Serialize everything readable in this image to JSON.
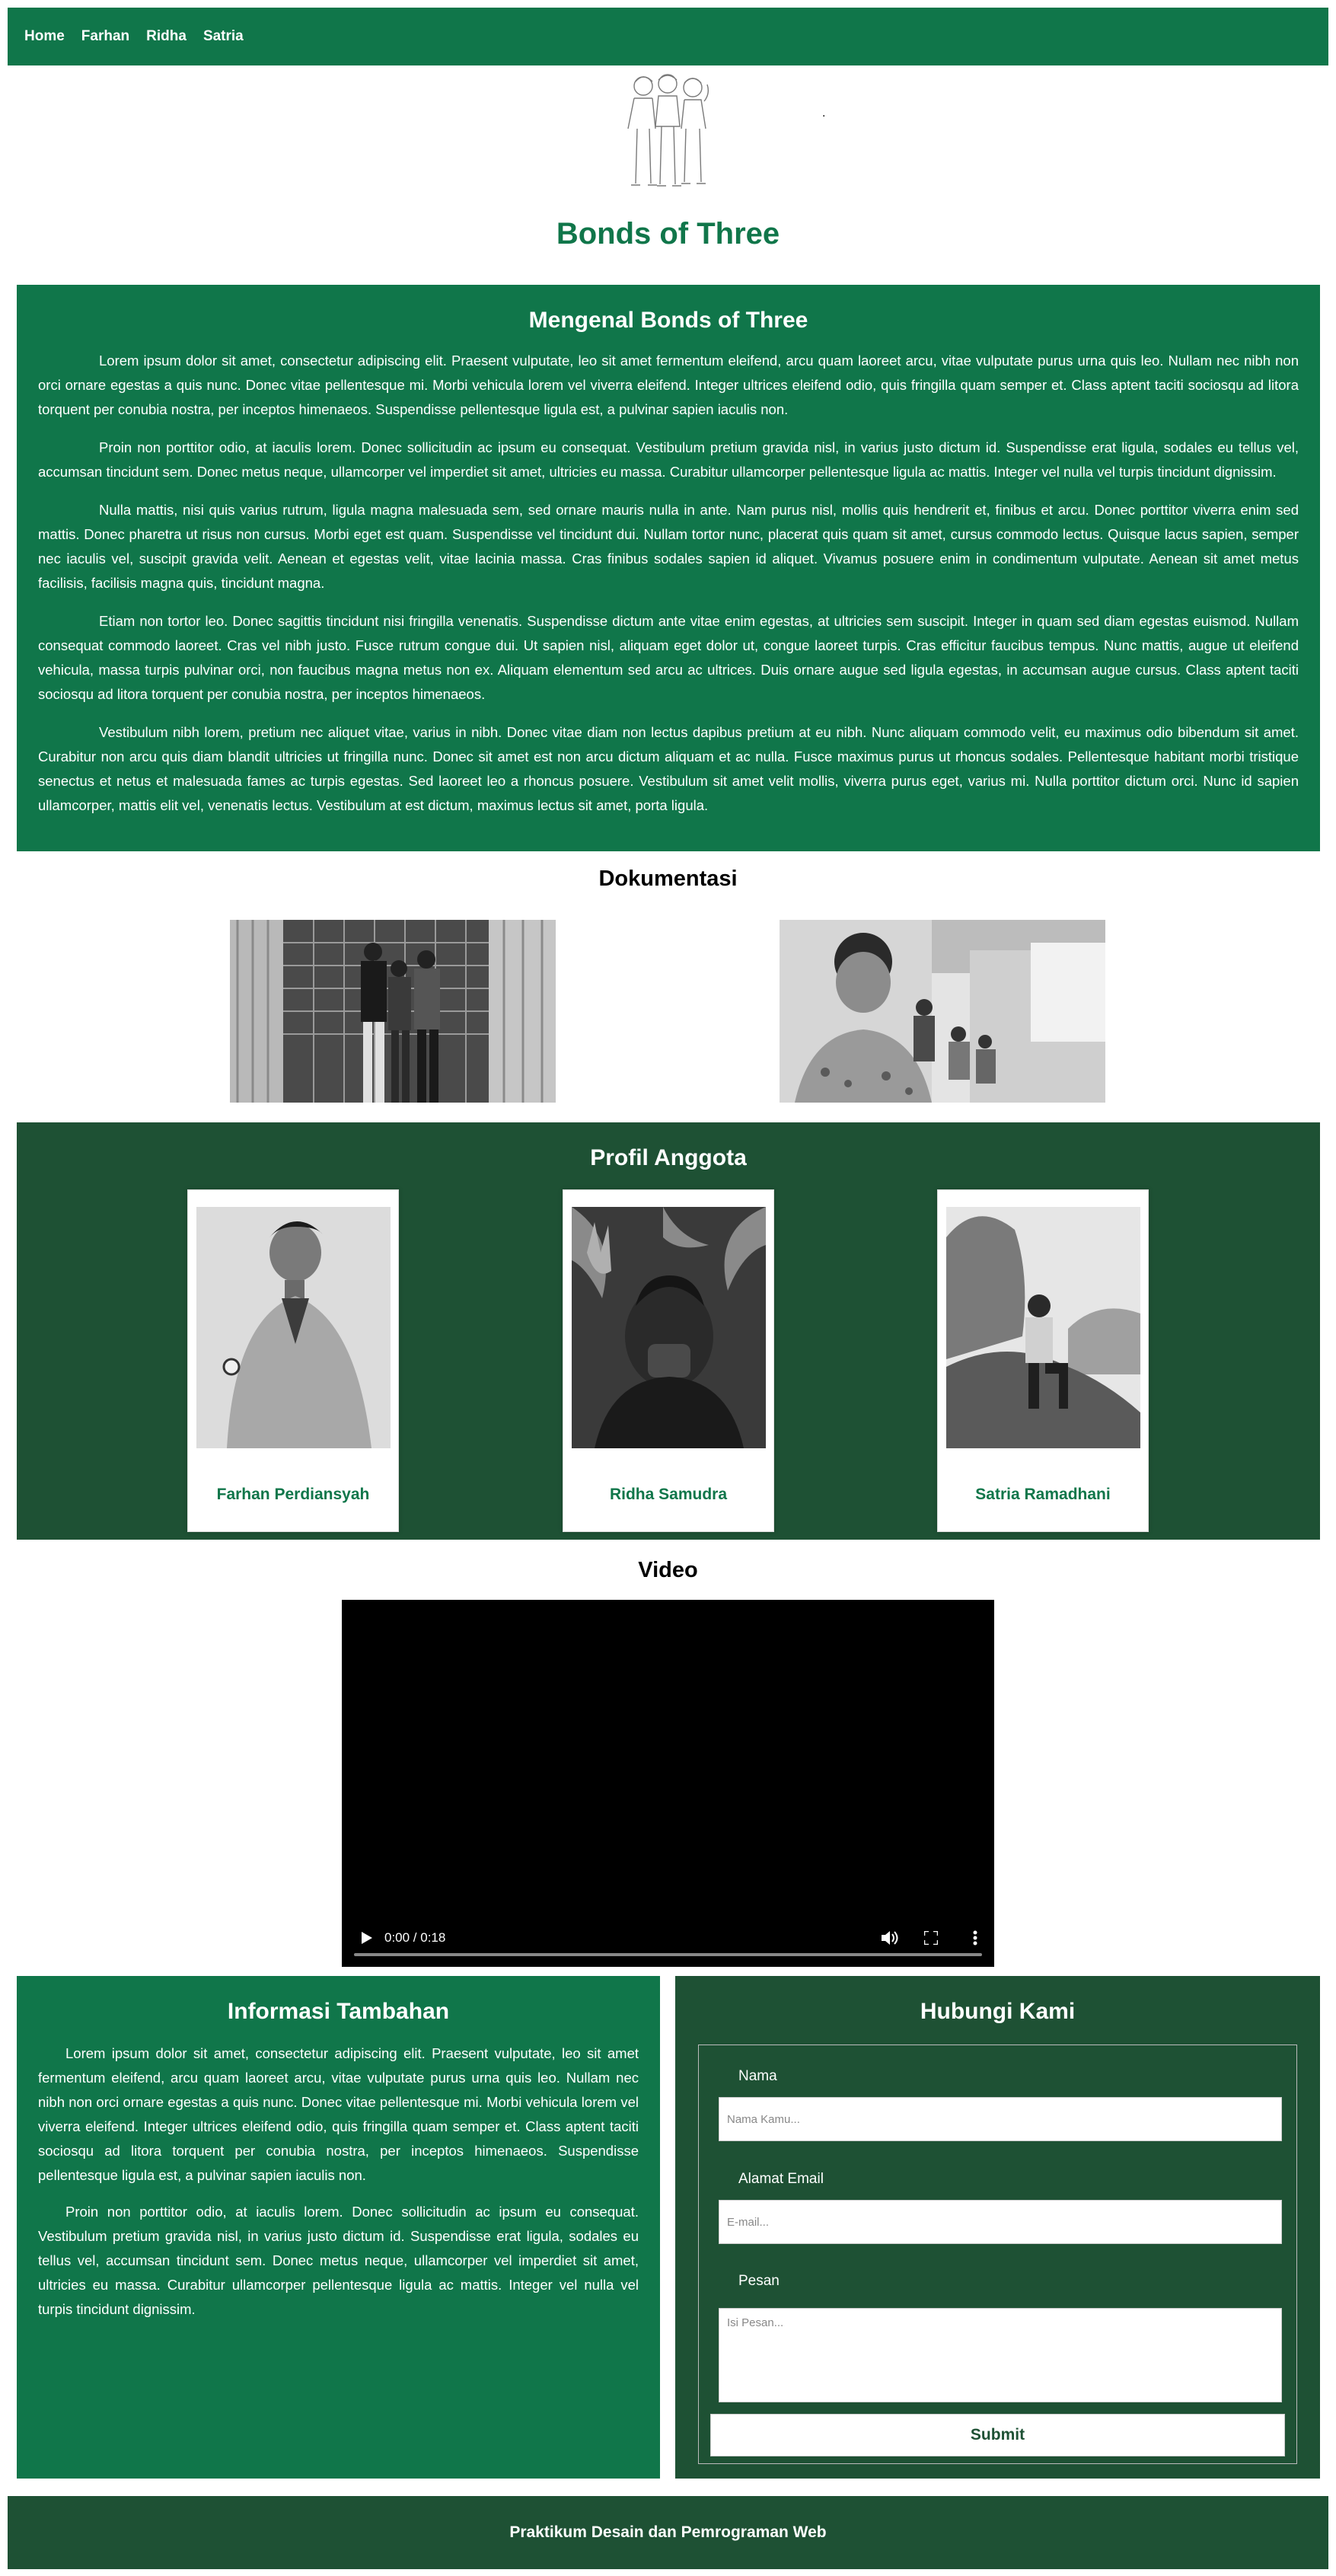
{
  "nav": {
    "links": [
      "Home",
      "Farhan",
      "Ridha",
      "Satria"
    ]
  },
  "header": {
    "title": "Bonds of Three",
    "dot": "."
  },
  "intro": {
    "title": "Mengenal Bonds of Three",
    "paragraphs": [
      "Lorem ipsum dolor sit amet, consectetur adipiscing elit. Praesent vulputate, leo sit amet fermentum eleifend, arcu quam laoreet arcu, vitae vulputate purus urna quis leo. Nullam nec nibh non orci ornare egestas a quis nunc. Donec vitae pellentesque mi. Morbi vehicula lorem vel viverra eleifend. Integer ultrices eleifend odio, quis fringilla quam semper et. Class aptent taciti sociosqu ad litora torquent per conubia nostra, per inceptos himenaeos. Suspendisse pellentesque ligula est, a pulvinar sapien iaculis non.",
      "Proin non porttitor odio, at iaculis lorem. Donec sollicitudin ac ipsum eu consequat. Vestibulum pretium gravida nisl, in varius justo dictum id. Suspendisse erat ligula, sodales eu tellus vel, accumsan tincidunt sem. Donec metus neque, ullamcorper vel imperdiet sit amet, ultricies eu massa. Curabitur ullamcorper pellentesque ligula ac mattis. Integer vel nulla vel turpis tincidunt dignissim.",
      "Nulla mattis, nisi quis varius rutrum, ligula magna malesuada sem, sed ornare mauris nulla in ante. Nam purus nisl, mollis quis hendrerit et, finibus et arcu. Donec porttitor viverra enim sed mattis. Donec pharetra ut risus non cursus. Morbi eget est quam. Suspendisse vel tincidunt dui. Nullam tortor nunc, placerat quis quam sit amet, cursus commodo lectus. Quisque lacus sapien, semper nec iaculis vel, suscipit gravida velit. Aenean et egestas velit, vitae lacinia massa. Cras finibus sodales sapien id aliquet. Vivamus posuere enim in condimentum vulputate. Aenean sit amet metus facilisis, facilisis magna quis, tincidunt magna.",
      "Etiam non tortor leo. Donec sagittis tincidunt nisi fringilla venenatis. Suspendisse dictum ante vitae enim egestas, at ultricies sem suscipit. Integer in quam sed diam egestas euismod. Nullam consequat commodo laoreet. Cras vel nibh justo. Fusce rutrum congue dui. Ut sapien nisl, aliquam eget dolor ut, congue laoreet turpis. Cras efficitur faucibus tempus. Nunc mattis, augue ut eleifend vehicula, massa turpis pulvinar orci, non faucibus magna metus non ex. Aliquam elementum sed arcu ac ultrices. Duis ornare augue sed ligula egestas, in accumsan augue cursus. Class aptent taciti sociosqu ad litora torquent per conubia nostra, per inceptos himenaeos.",
      "Vestibulum nibh lorem, pretium nec aliquet vitae, varius in nibh. Donec vitae diam non lectus dapibus pretium at eu nibh. Nunc aliquam commodo velit, eu maximus odio bibendum sit amet. Curabitur non arcu quis diam blandit ultricies ut fringilla nunc. Donec sit amet est non arcu dictum aliquam et ac nulla. Fusce maximus purus ut rhoncus sodales. Pellentesque habitant morbi tristique senectus et netus et malesuada fames ac turpis egestas. Sed laoreet leo a rhoncus posuere. Vestibulum sit amet velit mollis, viverra purus eget, varius mi. Nulla porttitor dictum orci. Nunc id sapien ullamcorper, mattis elit vel, venenatis lectus. Vestibulum at est dictum, maximus lectus sit amet, porta ligula."
    ]
  },
  "documentation": {
    "title": "Dokumentasi"
  },
  "profiles": {
    "title": "Profil Anggota",
    "members": [
      {
        "name": "Farhan Perdiansyah"
      },
      {
        "name": "Ridha Samudra"
      },
      {
        "name": "Satria Ramadhani"
      }
    ]
  },
  "video": {
    "title": "Video",
    "time": "0:00 / 0:18",
    "progress": 0
  },
  "info": {
    "title": "Informasi Tambahan",
    "paragraphs": [
      "Lorem ipsum dolor sit amet, consectetur adipiscing elit. Praesent vulputate, leo sit amet fermentum eleifend, arcu quam laoreet arcu, vitae vulputate purus urna quis leo. Nullam nec nibh non orci ornare egestas a quis nunc. Donec vitae pellentesque mi. Morbi vehicula lorem vel viverra eleifend. Integer ultrices eleifend odio, quis fringilla quam semper et. Class aptent taciti sociosqu ad litora torquent per conubia nostra, per inceptos himenaeos. Suspendisse pellentesque ligula est, a pulvinar sapien iaculis non.",
      "Proin non porttitor odio, at iaculis lorem. Donec sollicitudin ac ipsum eu consequat. Vestibulum pretium gravida nisl, in varius justo dictum id. Suspendisse erat ligula, sodales eu tellus vel, accumsan tincidunt sem. Donec metus neque, ullamcorper vel imperdiet sit amet, ultricies eu massa. Curabitur ullamcorper pellentesque ligula ac mattis. Integer vel nulla vel turpis tincidunt dignissim."
    ]
  },
  "contact": {
    "title": "Hubungi Kami",
    "name_label": "Nama",
    "name_placeholder": "Nama Kamu...",
    "email_label": "Alamat Email",
    "email_placeholder": "E-mail...",
    "message_label": "Pesan",
    "message_placeholder": "Isi Pesan...",
    "submit_label": "Submit"
  },
  "footer": {
    "text": "Praktikum Desain dan Pemrograman Web"
  },
  "colors": {
    "primary_green": "#10764a",
    "dark_green": "#1e5134",
    "white": "#ffffff"
  },
  "icons": [
    "play-icon",
    "volume-icon",
    "fullscreen-icon",
    "more-options-icon"
  ]
}
